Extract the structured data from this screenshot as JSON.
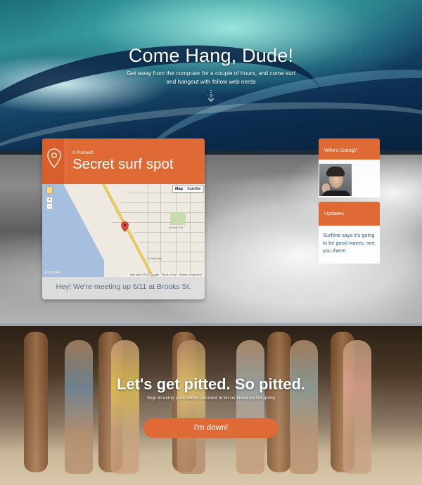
{
  "hero": {
    "title": "Come Hang, Dude!",
    "subtitle": "Get away from the computer for a couple of hours, and come surf and hangout with fellow web nerds",
    "scroll_icon": "scroll-down-arrow-icon"
  },
  "event_card": {
    "tag": "It Pushed!",
    "title": "Secret surf spot",
    "pin_icon": "location-pin-icon",
    "footer": "Hey! We're meeting up 6/11 at Brooks St.",
    "map": {
      "type_map": "Map",
      "type_satellite": "Satellite",
      "zoom_in": "+",
      "zoom_out": "−",
      "attribution": "Map data ©2013 Google · Terms of Use · Report a map error",
      "logo": "Google",
      "park_label": "Bluebird Park",
      "highway_label": "S Coast Hwy"
    }
  },
  "who_going": {
    "title": "Who's Going?"
  },
  "updates": {
    "title": "Updates",
    "text": "Surfline says it's going to be good waves, see you there!"
  },
  "cta": {
    "title": "Let's get pitted. So pitted.",
    "subtitle": "Sign in using your twitter account to let us know you're going",
    "button": "I'm down!"
  },
  "colors": {
    "accent": "#e06a35",
    "update_text": "#2f5d86",
    "card_footer_text": "#5a6f84"
  }
}
